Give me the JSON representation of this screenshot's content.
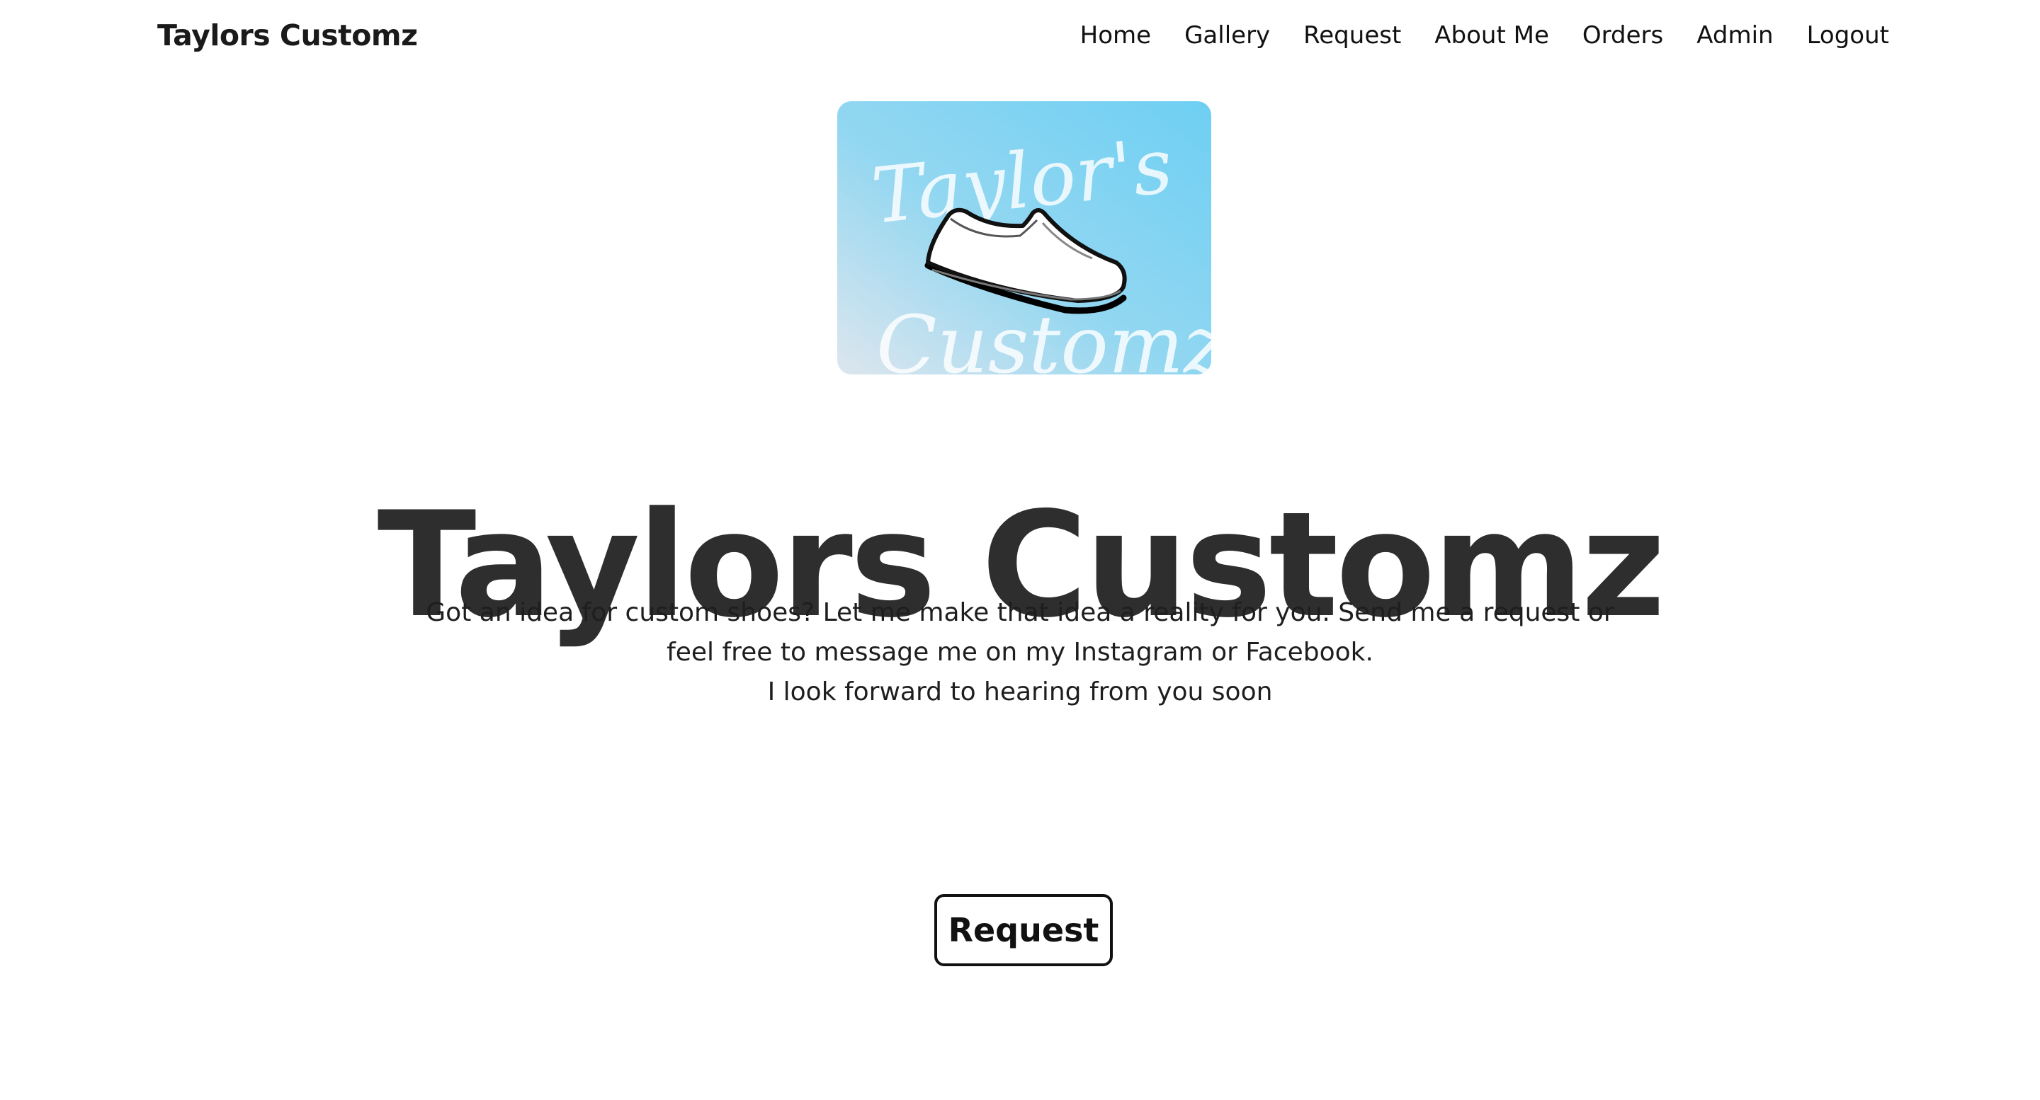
{
  "header": {
    "brand": "Taylors Customz",
    "nav": [
      {
        "label": "Home"
      },
      {
        "label": "Gallery"
      },
      {
        "label": "Request"
      },
      {
        "label": "About Me"
      },
      {
        "label": "Orders"
      },
      {
        "label": "Admin"
      },
      {
        "label": "Logout"
      }
    ]
  },
  "hero": {
    "logo": {
      "top_text": "Taylor's",
      "bottom_text": "Customz",
      "icon": "slip-on-shoe-icon"
    },
    "title": "Taylors Customz",
    "description": [
      "Got an idea for custom shoes? Let me make that idea a reality for you. Send me a request or",
      "feel free to message me on my Instagram or Facebook.",
      "I look forward to hearing from you soon"
    ],
    "button_label": "Request"
  },
  "colors": {
    "title": "#2e2e2e",
    "logo_gradient_start": "#dde6ee",
    "logo_gradient_end": "#6ecff3"
  }
}
